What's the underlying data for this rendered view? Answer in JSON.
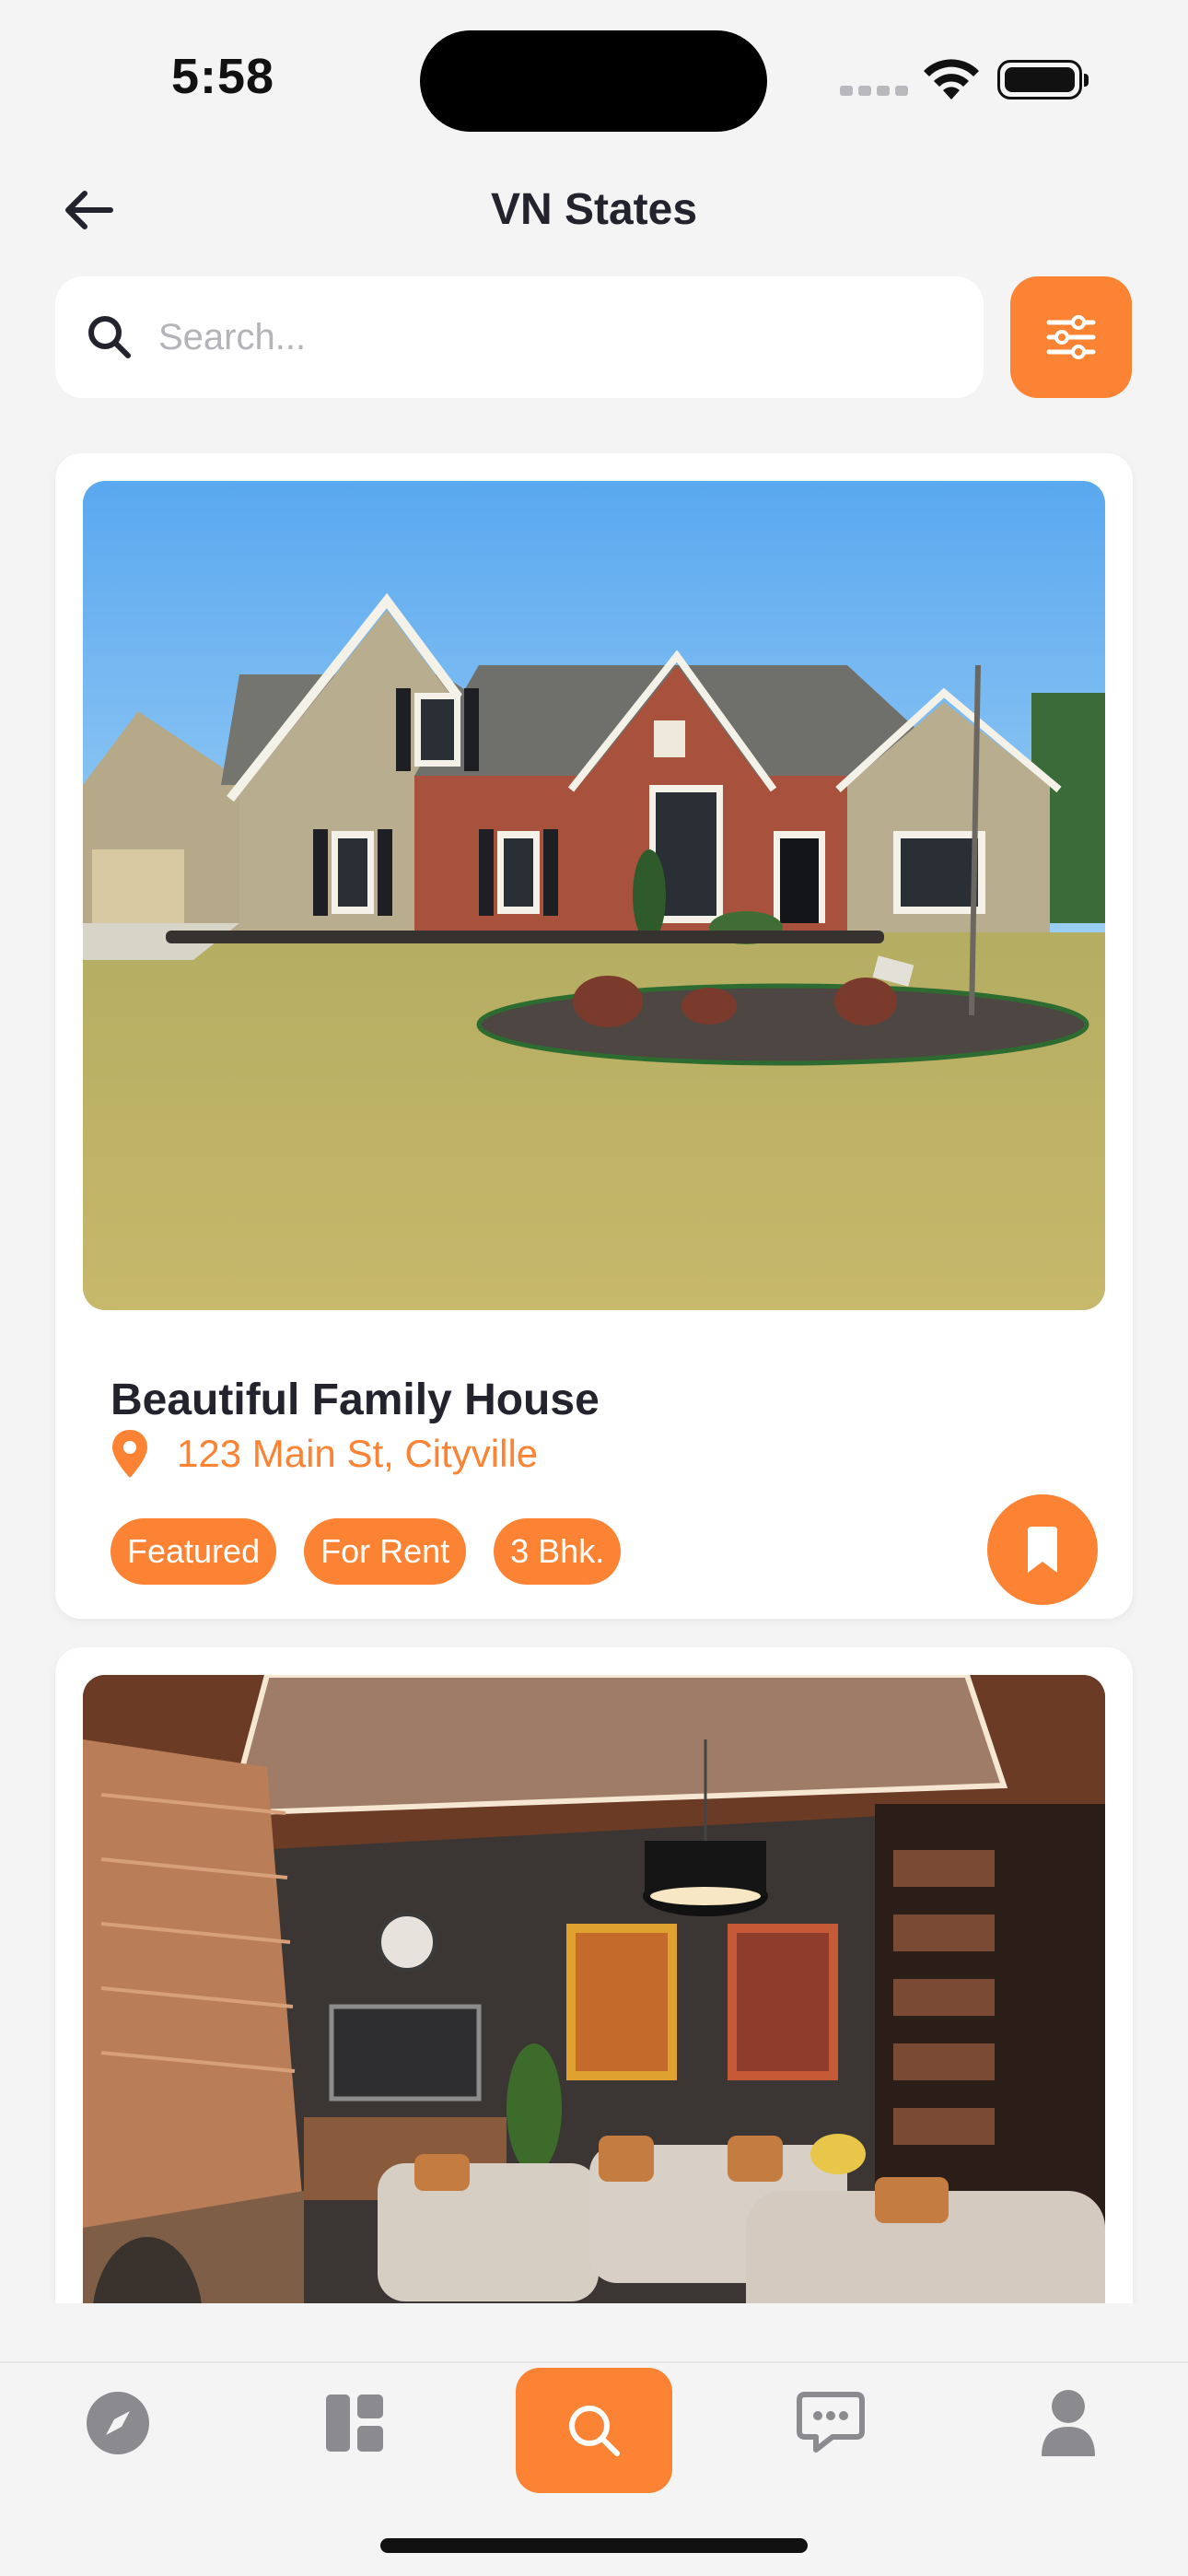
{
  "status_bar": {
    "time": "5:58"
  },
  "header": {
    "title": "VN States"
  },
  "search": {
    "placeholder": "Search..."
  },
  "listings": [
    {
      "title": "Beautiful Family House",
      "location": "123 Main St, Cityville",
      "tags": [
        "Featured",
        "For Rent",
        "3 Bhk."
      ],
      "image": "house-exterior-photo"
    },
    {
      "image": "living-room-interior-photo"
    }
  ],
  "tabbar": {
    "items": [
      "explore",
      "dashboard",
      "search",
      "messages",
      "profile"
    ],
    "active": "search"
  },
  "colors": {
    "accent": "#fb8333",
    "background": "#f4f4f5",
    "text": "#23232d"
  }
}
